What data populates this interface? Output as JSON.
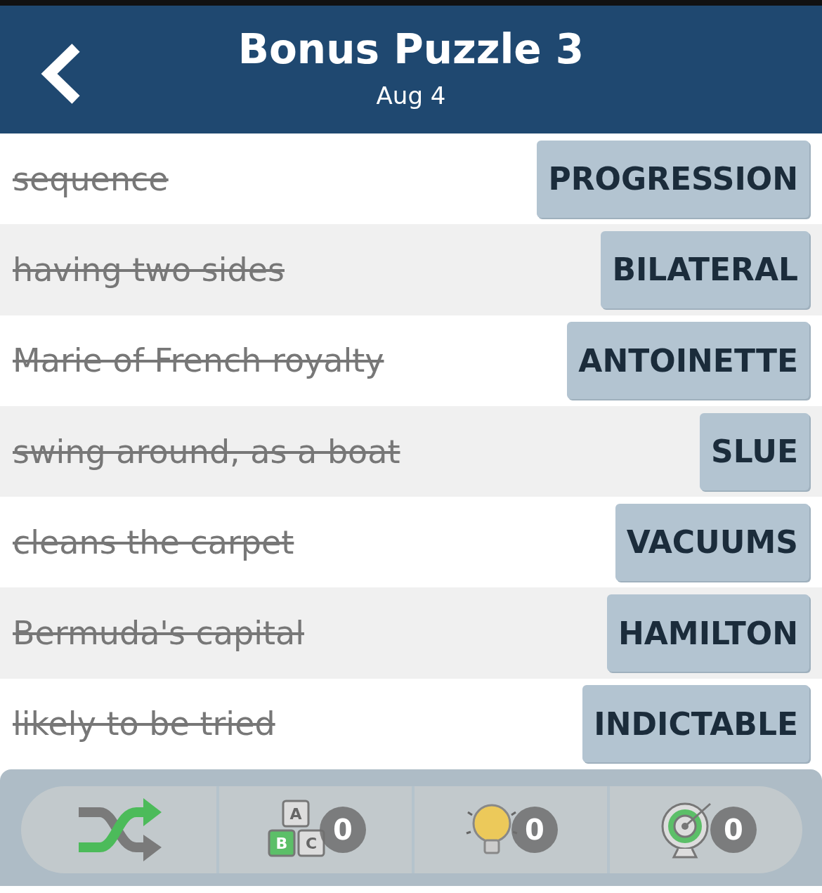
{
  "header": {
    "title": "Bonus Puzzle 3",
    "date": "Aug 4"
  },
  "rows": [
    {
      "clue": "sequence",
      "answer": "PROGRESSION",
      "solved": true
    },
    {
      "clue": "having two sides",
      "answer": "BILATERAL",
      "solved": true
    },
    {
      "clue": "Marie of French royalty",
      "answer": "ANTOINETTE",
      "solved": true
    },
    {
      "clue": "swing around, as a boat",
      "answer": "SLUE",
      "solved": true
    },
    {
      "clue": "cleans the carpet",
      "answer": "VACUUMS",
      "solved": true
    },
    {
      "clue": "Bermuda's capital",
      "answer": "HAMILTON",
      "solved": true
    },
    {
      "clue": "likely to be tried",
      "answer": "INDICTABLE",
      "solved": true
    }
  ],
  "toolbar": [
    {
      "kind": "shuffle"
    },
    {
      "kind": "letters",
      "count": "0",
      "letters": [
        "A",
        "B",
        "C"
      ]
    },
    {
      "kind": "hint",
      "count": "0"
    },
    {
      "kind": "target",
      "count": "0"
    }
  ]
}
